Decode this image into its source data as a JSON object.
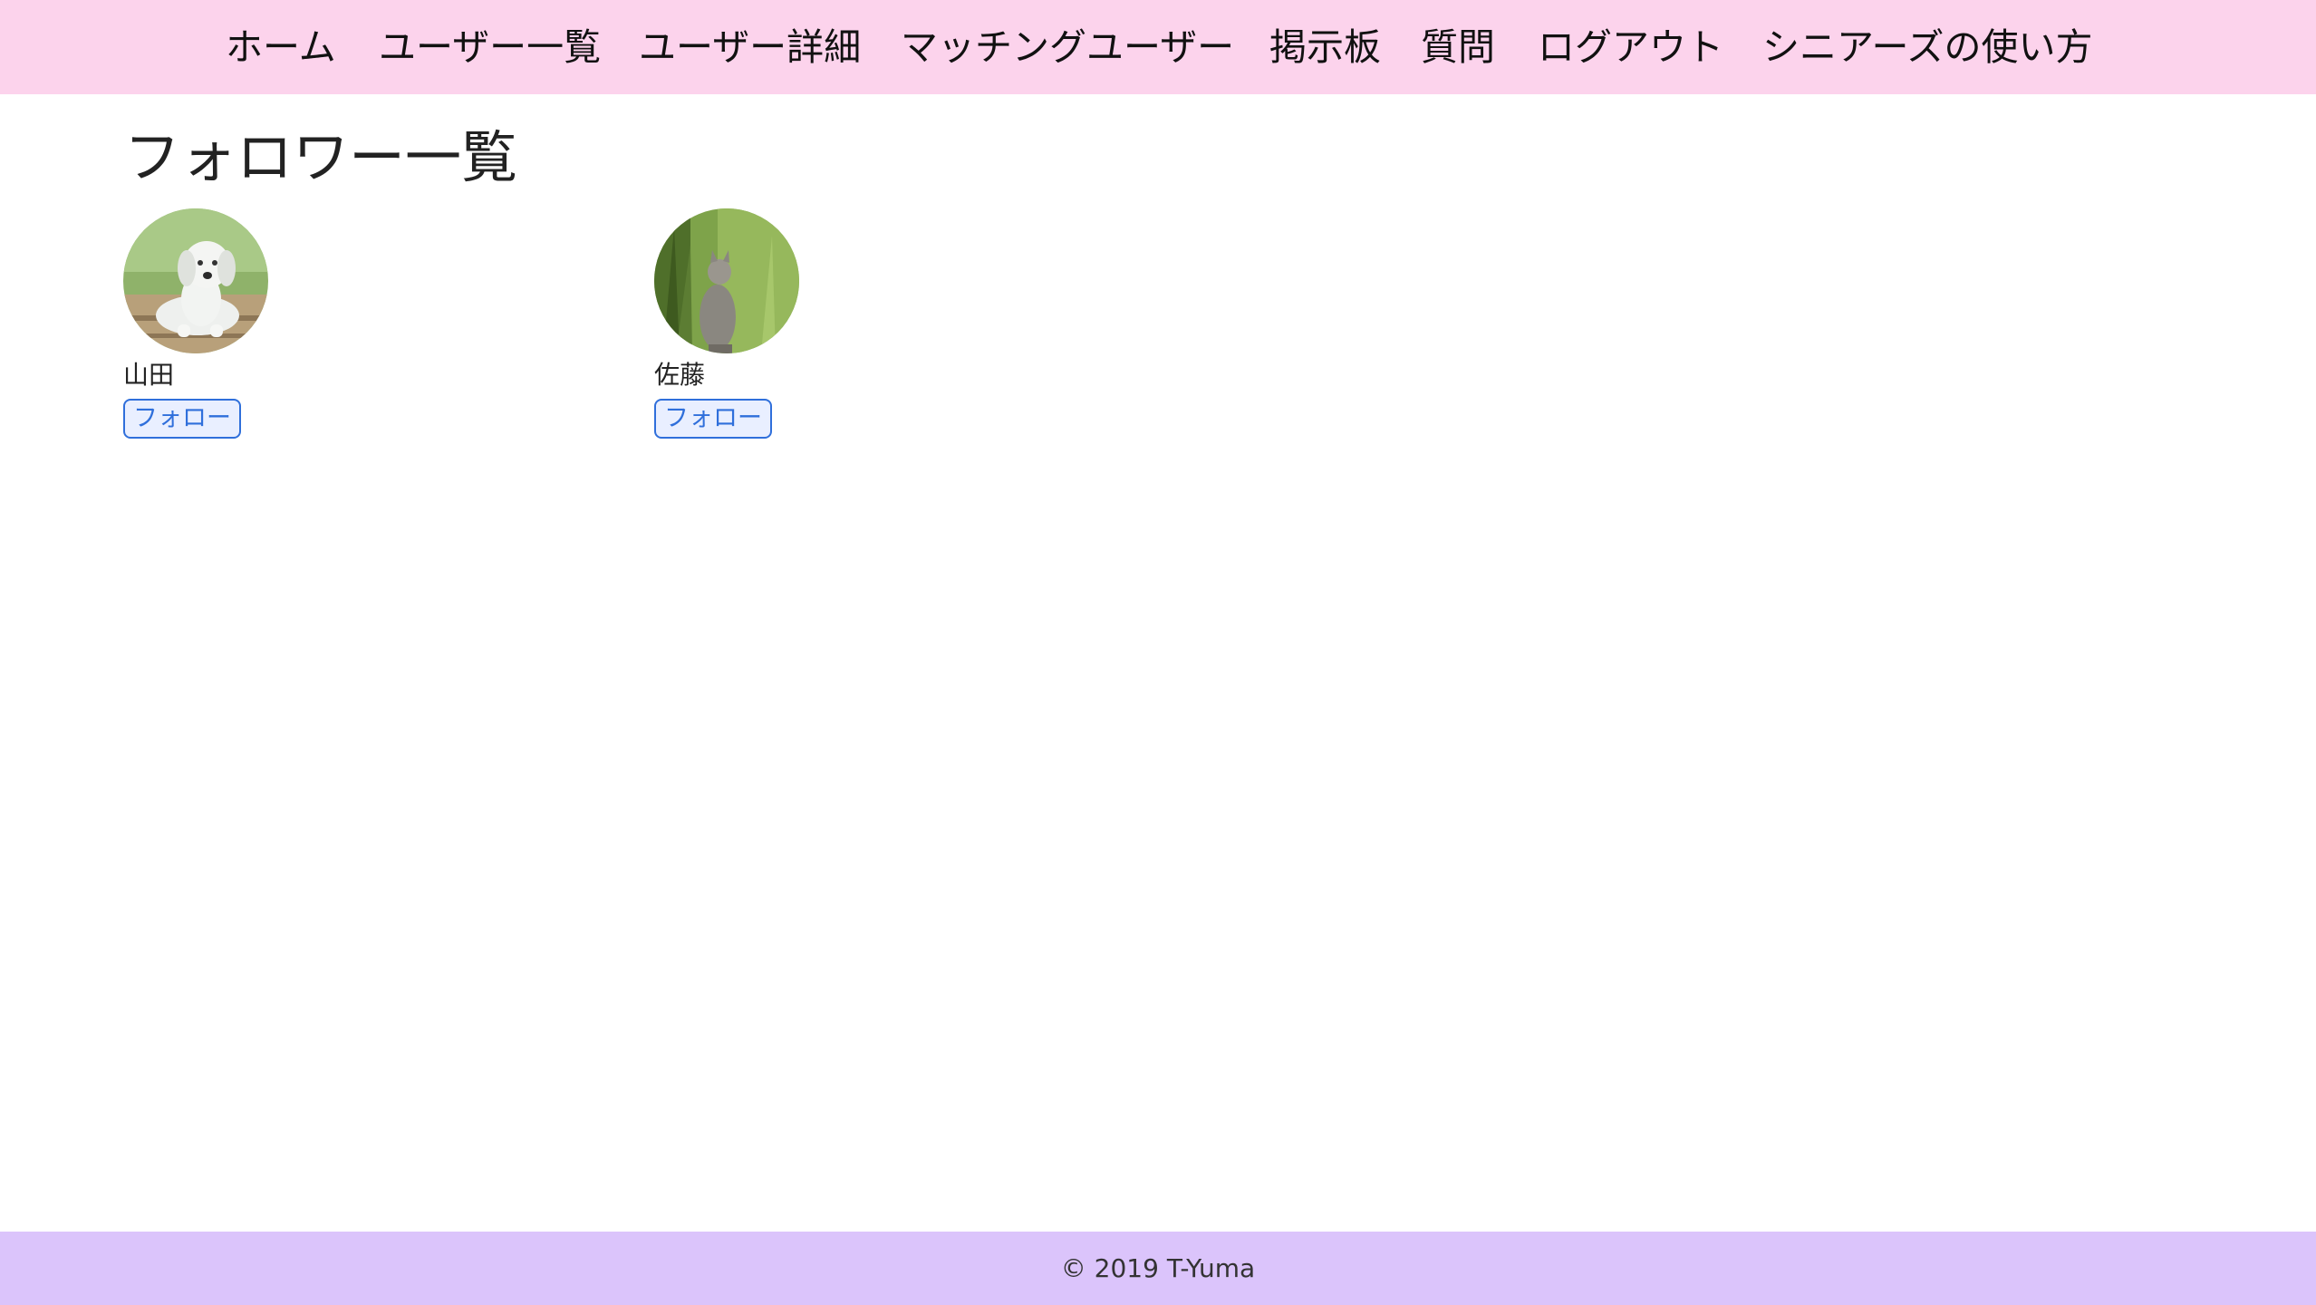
{
  "nav": {
    "items": [
      {
        "label": "ホーム"
      },
      {
        "label": "ユーザー一覧"
      },
      {
        "label": "ユーザー詳細"
      },
      {
        "label": "マッチングユーザー"
      },
      {
        "label": "掲示板"
      },
      {
        "label": "質問"
      },
      {
        "label": "ログアウト"
      },
      {
        "label": "シニアーズの使い方"
      }
    ]
  },
  "page": {
    "title": "フォロワー一覧"
  },
  "followers": [
    {
      "name": "山田",
      "follow_label": "フォロー",
      "avatar": "puppy-photo"
    },
    {
      "name": "佐藤",
      "follow_label": "フォロー",
      "avatar": "cat-photo"
    }
  ],
  "footer": {
    "copyright": "© 2019 T-Yuma"
  },
  "colors": {
    "navbar_bg": "#fcd3ec",
    "footer_bg": "#dbc4fb",
    "button_accent": "#2f6fdb"
  }
}
